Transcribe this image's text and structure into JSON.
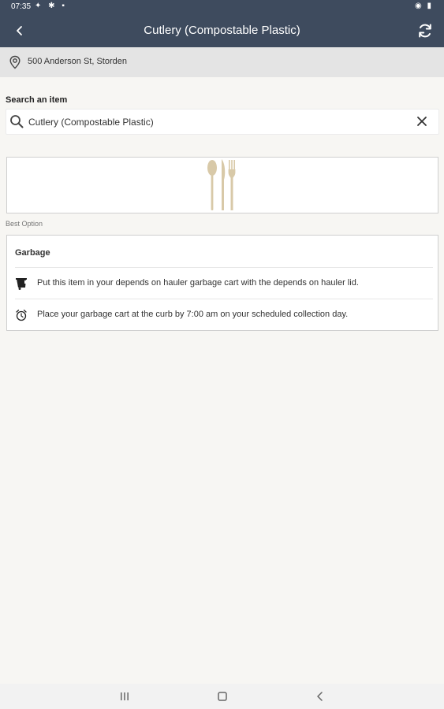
{
  "status_bar": {
    "time": "07:35"
  },
  "header": {
    "title": "Cutlery (Compostable Plastic)"
  },
  "address": {
    "text": "500 Anderson St, Storden"
  },
  "search": {
    "label": "Search an item",
    "value": "Cutlery (Compostable Plastic)"
  },
  "result": {
    "section_label": "Best Option",
    "category": "Garbage",
    "instructions": [
      {
        "icon": "garbage-cart-icon",
        "text": "Put this item in your depends on hauler garbage cart with the depends on hauler lid."
      },
      {
        "icon": "alarm-clock-icon",
        "text": "Place your garbage cart at the curb by 7:00 am on your scheduled collection day."
      }
    ]
  },
  "colors": {
    "header_bg": "#3e4b5e",
    "address_bg": "#e4e4e4",
    "cutlery": "#d8c9a8"
  }
}
